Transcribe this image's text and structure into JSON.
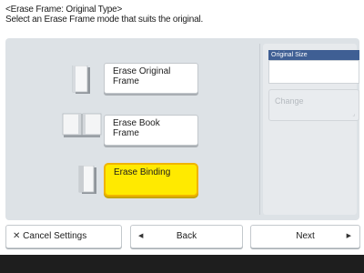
{
  "header": {
    "title": "<Erase Frame: Original Type>",
    "instruction": "Select an Erase Frame mode that suits the original."
  },
  "modes": [
    {
      "label_line1": "Erase Original",
      "label_line2": "Frame",
      "selected": false
    },
    {
      "label_line1": "Erase Book",
      "label_line2": "Frame",
      "selected": false
    },
    {
      "label_line1": "Erase Binding",
      "label_line2": "",
      "selected": true
    }
  ],
  "original_size": {
    "label": "Original Size",
    "value": "",
    "change_label": "Change"
  },
  "footer": {
    "cancel_label": "Cancel Settings",
    "back_label": "Back",
    "next_label": "Next"
  },
  "icons": {
    "cancel": "close-icon",
    "back": "arrow-left-icon",
    "next": "arrow-right-icon"
  },
  "colors": {
    "selected_fill": "#ffea00",
    "selected_border": "#f0b400",
    "panel": "#dde2e6",
    "label_bar": "#3f5f94",
    "bottom_bar": "#1e1e1e"
  }
}
